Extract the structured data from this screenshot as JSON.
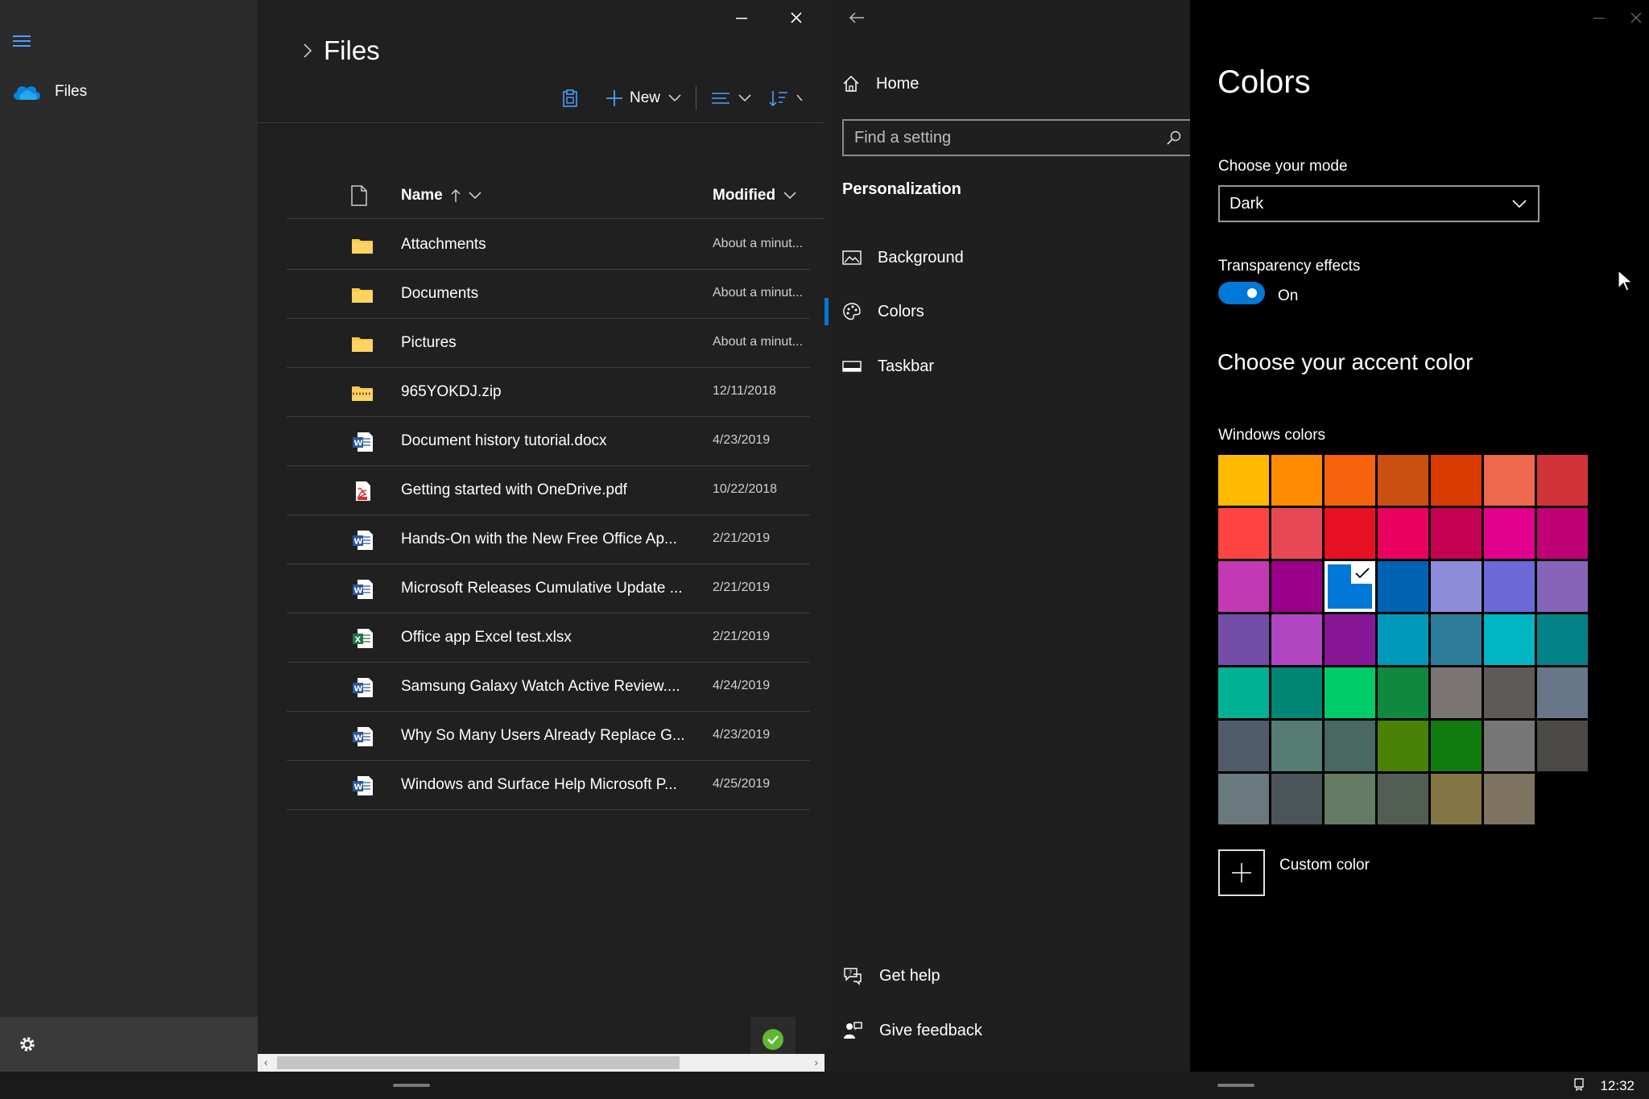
{
  "onedrive": {
    "nav": {
      "files_label": "Files"
    },
    "title": "Files",
    "toolbar": {
      "new_label": "New"
    },
    "columns": {
      "name": "Name",
      "modified": "Modified"
    },
    "files": [
      {
        "name": "Attachments",
        "modified": "About a minut...",
        "icon": "folder-icon"
      },
      {
        "name": "Documents",
        "modified": "About a minut...",
        "icon": "folder-icon"
      },
      {
        "name": "Pictures",
        "modified": "About a minut...",
        "icon": "folder-icon"
      },
      {
        "name": "965YOKDJ.zip",
        "modified": "12/11/2018",
        "icon": "zip-folder-icon"
      },
      {
        "name": "Document history tutorial.docx",
        "modified": "4/23/2019",
        "icon": "word-file-icon"
      },
      {
        "name": "Getting started with OneDrive.pdf",
        "modified": "10/22/2018",
        "icon": "pdf-file-icon"
      },
      {
        "name": "Hands-On with the New Free Office Ap...",
        "modified": "2/21/2019",
        "icon": "word-file-icon"
      },
      {
        "name": "Microsoft Releases Cumulative Update ...",
        "modified": "2/21/2019",
        "icon": "word-file-icon"
      },
      {
        "name": "Office app Excel test.xlsx",
        "modified": "2/21/2019",
        "icon": "excel-file-icon"
      },
      {
        "name": "Samsung Galaxy Watch Active Review....",
        "modified": "4/24/2019",
        "icon": "word-file-icon"
      },
      {
        "name": "Why So Many Users Already Replace G...",
        "modified": "4/23/2019",
        "icon": "word-file-icon"
      },
      {
        "name": "Windows and Surface Help Microsoft P...",
        "modified": "4/25/2019",
        "icon": "word-file-icon"
      }
    ]
  },
  "settings": {
    "nav": {
      "home": "Home",
      "search_placeholder": "Find a setting",
      "section": "Personalization",
      "items": [
        "Background",
        "Colors",
        "Taskbar"
      ],
      "help": "Get help",
      "feedback": "Give feedback"
    },
    "page": {
      "title": "Colors",
      "mode_label": "Choose your mode",
      "mode_value": "Dark",
      "transparency_label": "Transparency effects",
      "transparency_state": "On",
      "accent_title": "Choose your accent color",
      "windows_colors_label": "Windows colors",
      "custom_color_label": "Custom color",
      "selected_swatch_index": 16,
      "swatches": [
        "#FFB900",
        "#FF8C00",
        "#F7630C",
        "#CA5010",
        "#DA3B01",
        "#EF6950",
        "#D13438",
        "#FF4343",
        "#E74856",
        "#E81123",
        "#EA005E",
        "#C30052",
        "#E3008C",
        "#BF0077",
        "#C239B3",
        "#9A0089",
        "#0078D7",
        "#0063B1",
        "#8E8CD8",
        "#6B69D6",
        "#8764B8",
        "#744DA9",
        "#B146C2",
        "#881798",
        "#0099BC",
        "#2D7D9A",
        "#00B7C3",
        "#038387",
        "#00B294",
        "#018574",
        "#00CC6A",
        "#10893E",
        "#7A7574",
        "#5D5A58",
        "#68768A",
        "#515C6B",
        "#567C73",
        "#486860",
        "#498205",
        "#107C10",
        "#767676",
        "#4C4A48",
        "#69797E",
        "#4A5459",
        "#647C64",
        "#525E54",
        "#847545",
        "#7E735F"
      ]
    }
  },
  "taskbar": {
    "clock": "12:32"
  },
  "colors": {
    "accent": "#0078D7",
    "folder": "#F8C94A"
  }
}
